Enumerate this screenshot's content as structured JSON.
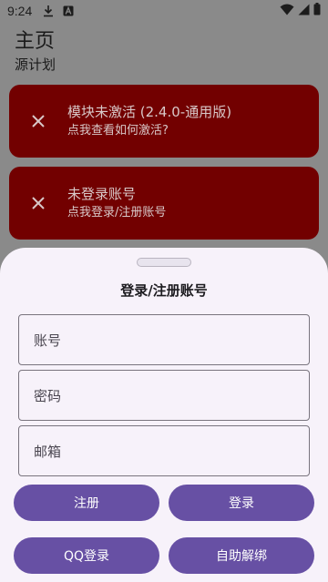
{
  "status_bar": {
    "time": "9:24",
    "icons": [
      "download-icon",
      "a-letter-icon",
      "wifi-icon",
      "signal-icon",
      "battery-icon"
    ]
  },
  "page": {
    "title": "主页",
    "subtitle": "源计划"
  },
  "alerts": [
    {
      "title": "模块未激活 (2.4.0-通用版)",
      "desc": "点我查看如何激活?"
    },
    {
      "title": "未登录账号",
      "desc": "点我登录/注册账号"
    }
  ],
  "sheet": {
    "title": "登录/注册账号",
    "fields": {
      "account_placeholder": "账号",
      "password_placeholder": "密码",
      "email_placeholder": "邮箱"
    },
    "buttons": {
      "register": "注册",
      "login": "登录",
      "qq_login": "QQ登录",
      "self_unbind": "自助解绑"
    }
  },
  "colors": {
    "alert_bg": "#720000",
    "primary": "#6750a4",
    "sheet_bg": "#f7f2fa",
    "scrim": "#8a8a8a"
  }
}
